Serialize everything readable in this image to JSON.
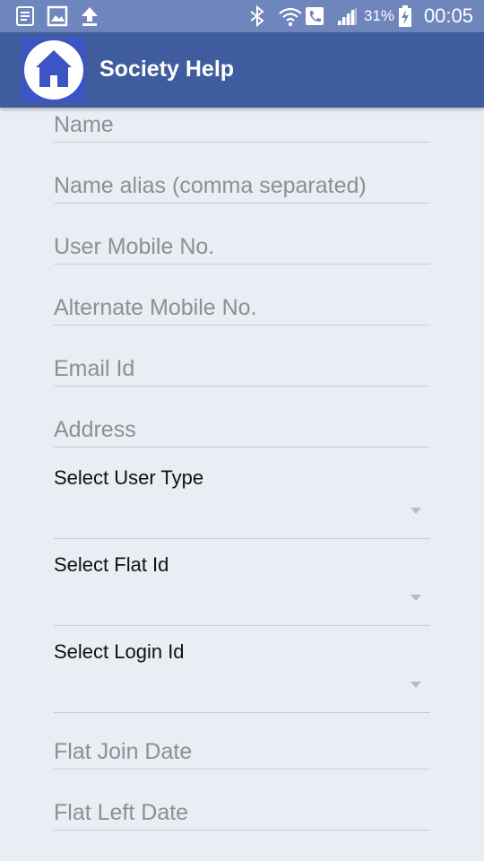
{
  "status_bar": {
    "battery_percent": "31%",
    "time": "00:05"
  },
  "app_bar": {
    "title": "Society Help"
  },
  "form": {
    "name": {
      "placeholder": "Name"
    },
    "name_alias": {
      "placeholder": "Name alias (comma separated)"
    },
    "user_mobile": {
      "placeholder": "User Mobile No."
    },
    "alternate_mobile": {
      "placeholder": "Alternate Mobile No."
    },
    "email": {
      "placeholder": "Email Id"
    },
    "address": {
      "placeholder": "Address"
    },
    "user_type": {
      "label": "Select User Type"
    },
    "flat_id": {
      "label": "Select Flat Id"
    },
    "login_id": {
      "label": "Select Login Id"
    },
    "flat_join_date": {
      "placeholder": "Flat Join Date"
    },
    "flat_left_date": {
      "placeholder": "Flat Left Date"
    }
  }
}
